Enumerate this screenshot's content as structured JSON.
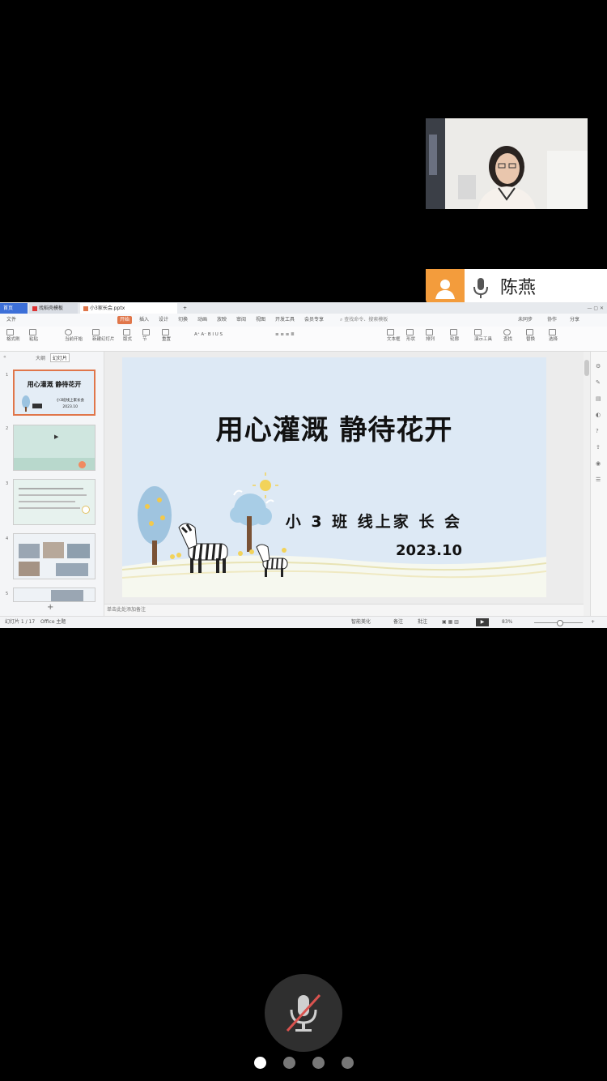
{
  "participant": {
    "name": "陈燕"
  },
  "app": {
    "tabs": [
      {
        "label": "首页"
      },
      {
        "label": "找稻壳模板"
      },
      {
        "label": "小3家长会.pptx"
      }
    ],
    "ribbon_tabs": [
      "文件",
      "开始",
      "插入",
      "设计",
      "切换",
      "动画",
      "放映",
      "审阅",
      "视图",
      "开发工具",
      "会员专享"
    ],
    "active_ribbon_tab": "开始",
    "search_placeholder": "查找命令、搜索模板",
    "top_right": [
      "未同步",
      "协作",
      "分享"
    ],
    "ribbon_buttons": [
      "格式刷",
      "粘贴",
      "当前开始",
      "新建幻灯片",
      "版式",
      "节",
      "重置",
      "文本框",
      "形状",
      "排列",
      "轮廓",
      "演示工具",
      "查找",
      "替换",
      "选择"
    ],
    "panel_tabs": [
      "大纲",
      "幻灯片"
    ],
    "notes_placeholder": "单击此处添加备注",
    "status": {
      "slide_counter": "幻灯片 1 / 17",
      "theme": "Office 主题",
      "beautify": "智能美化",
      "notes": "备注",
      "comments": "批注",
      "zoom": "83%"
    }
  },
  "slide": {
    "title": "用心灌溉  静待花开",
    "subtitle": "小 3 班 线上家 长 会",
    "date": "2023.10"
  },
  "thumbnails": [
    {
      "num": "1",
      "title": "用心灌溉  静待花开",
      "sub": "小3班线上家长会",
      "date": "2023.10"
    },
    {
      "num": "2"
    },
    {
      "num": "3"
    },
    {
      "num": "4"
    },
    {
      "num": "5"
    }
  ],
  "pager": {
    "count": 4,
    "active": 0
  },
  "colors": {
    "accent": "#f39c3c",
    "slide_bg": "#dde9f5",
    "selected_thumb": "#e0764a"
  }
}
